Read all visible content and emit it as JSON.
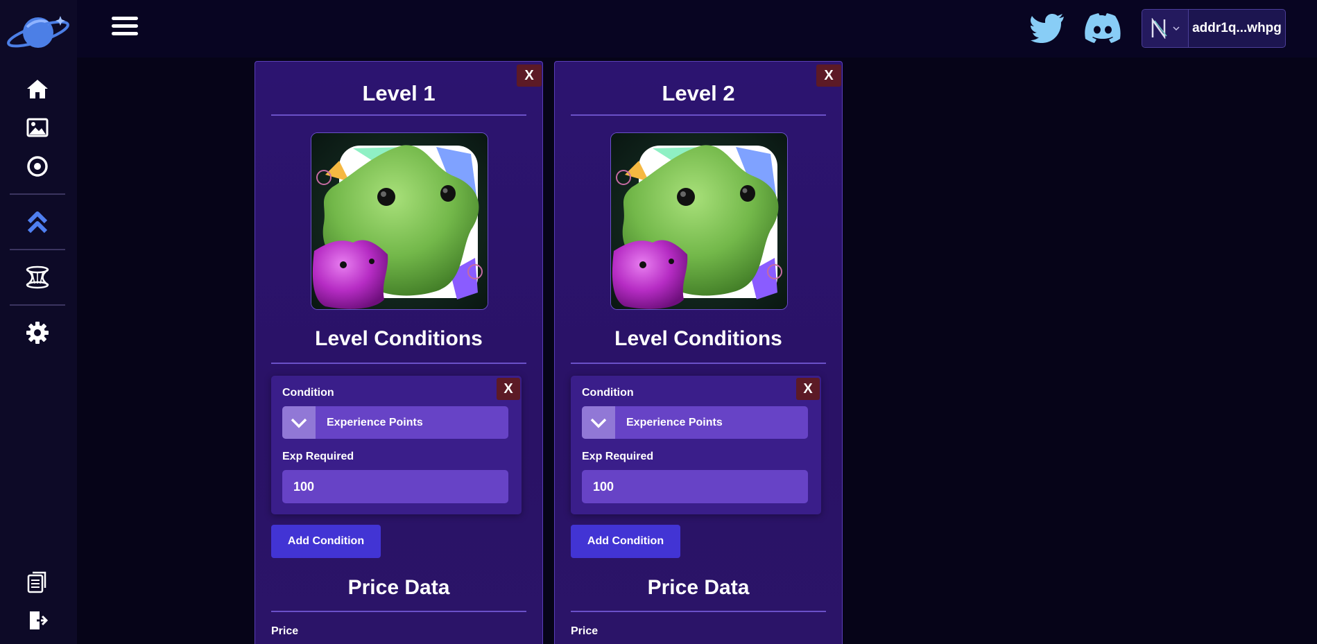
{
  "sidebar": {
    "icons": [
      "planet-logo-icon",
      "home-icon",
      "image-icon",
      "compass-icon",
      "chevrons-up-icon",
      "portal-icon",
      "gear-icon",
      "documents-icon",
      "logout-icon"
    ]
  },
  "topbar": {
    "social": [
      "twitter-icon",
      "discord-icon"
    ],
    "wallet": {
      "address": "addr1q...whpg",
      "logo_letter": "N"
    }
  },
  "colors": {
    "accent": "#4234d4",
    "card_bg": "#2c1470",
    "close_bg": "#5c1a26",
    "input_bg": "#6743c6"
  },
  "levels": [
    {
      "title": "Level 1",
      "close_label": "X",
      "conditions_title": "Level Conditions",
      "condition": {
        "close_label": "X",
        "condition_label": "Condition",
        "condition_value": "Experience Points",
        "exp_label": "Exp Required",
        "exp_value": "100"
      },
      "add_condition_label": "Add Condition",
      "price_title": "Price Data",
      "price_label": "Price"
    },
    {
      "title": "Level 2",
      "close_label": "X",
      "conditions_title": "Level Conditions",
      "condition": {
        "close_label": "X",
        "condition_label": "Condition",
        "condition_value": "Experience Points",
        "exp_label": "Exp Required",
        "exp_value": "100"
      },
      "add_condition_label": "Add Condition",
      "price_title": "Price Data",
      "price_label": "Price"
    }
  ]
}
